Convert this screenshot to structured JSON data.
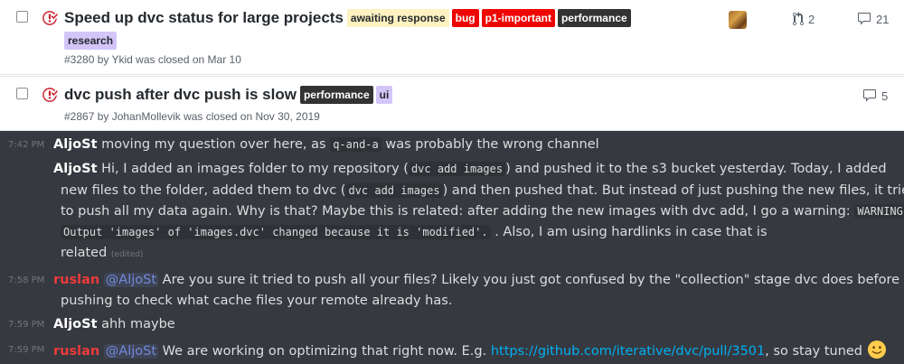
{
  "issues": [
    {
      "title": "Speed up dvc status for large projects",
      "labels": [
        "awaiting response",
        "bug",
        "p1-important",
        "performance",
        "research"
      ],
      "meta": "#3280 by Ykid was closed on Mar 10",
      "prs": "2",
      "comments": "21"
    },
    {
      "title": "dvc push after dvc push is slow",
      "labels": [
        "performance",
        "ui"
      ],
      "meta": "#2867 by JohanMollevik was closed on Nov 30, 2019",
      "comments": "5"
    }
  ],
  "chat": {
    "m1": {
      "time": "7:42 PM",
      "author": "AljoSt",
      "t1": "moving my question over here, as",
      "code1": "q-and-a",
      "t2": "was probably the wrong channel"
    },
    "m2": {
      "author": "AljoSt",
      "l1a": "Hi, I added an images folder to my repository (",
      "l1code": "dvc add images",
      "l1b": ") and pushed it to the s3 bucket yesterday. Today, I added",
      "l2a": "new files to the folder, added them to dvc (",
      "l2code": "dvc add images",
      "l2b": ") and then pushed that. But instead of just pushing the new files, it tried",
      "l3a": "to push all my data again. Why is that? Maybe this is related: after adding the new images with dvc add, I go a warning:",
      "l3code": "WARNING:",
      "l4code": "Output 'images' of 'images.dvc' changed because it is 'modified'.",
      "l4b": ". Also, I am using hardlinks in case that is",
      "l5a": "related",
      "edited": "(edited)"
    },
    "m3": {
      "time": "7:58 PM",
      "author": "ruslan",
      "mention": "@AljoSt",
      "l1": "Are you sure it tried to push all your files? Likely you just got confused by the \"collection\" stage dvc does before",
      "l2": "pushing to check what cache files your remote already has."
    },
    "m4": {
      "time": "7:59 PM",
      "author": "AljoSt",
      "text": "ahh maybe"
    },
    "m5": {
      "time": "7:59 PM",
      "author": "ruslan",
      "mention": "@AljoSt",
      "t1": "We are working on optimizing that right now. E.g.",
      "link": "https://github.com/iterative/dvc/pull/3501",
      "t2": ", so stay tuned"
    }
  },
  "colors": {
    "closed_icon": "#cb2431",
    "chat_bg": "#36393f",
    "link": "#00b0f4",
    "mention": "#7289da",
    "ruslan": "#ed3b3b"
  }
}
